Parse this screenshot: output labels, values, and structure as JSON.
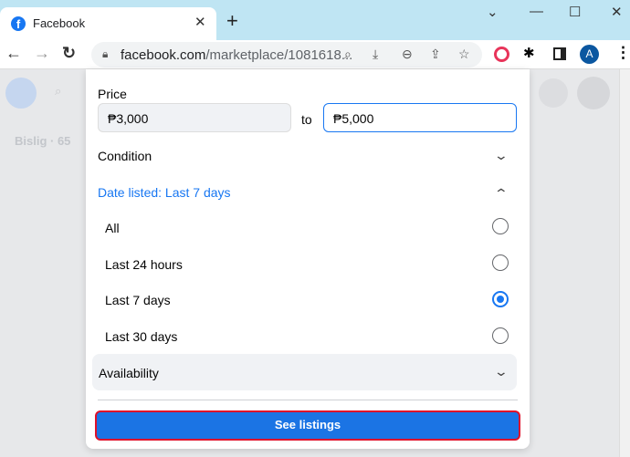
{
  "browser": {
    "tab_title": "Facebook",
    "new_tab": "+",
    "url_host": "facebook.com",
    "url_path": "/marketplace/1081618...",
    "profile_initial": "A"
  },
  "page_bg": {
    "location": "Bislig · 65"
  },
  "filters": {
    "price": {
      "label": "Price",
      "min": "₱3,000",
      "to": "to",
      "max": "₱5,000"
    },
    "condition": {
      "label": "Condition"
    },
    "date_listed": {
      "label": "Date listed: Last 7 days",
      "options": [
        {
          "label": "All",
          "selected": false
        },
        {
          "label": "Last 24 hours",
          "selected": false
        },
        {
          "label": "Last 7 days",
          "selected": true
        },
        {
          "label": "Last 30 days",
          "selected": false
        }
      ]
    },
    "availability": {
      "label": "Availability"
    },
    "see_listings": "See listings"
  },
  "colors": {
    "accent": "#1877f2",
    "highlight": "#e0102a"
  }
}
